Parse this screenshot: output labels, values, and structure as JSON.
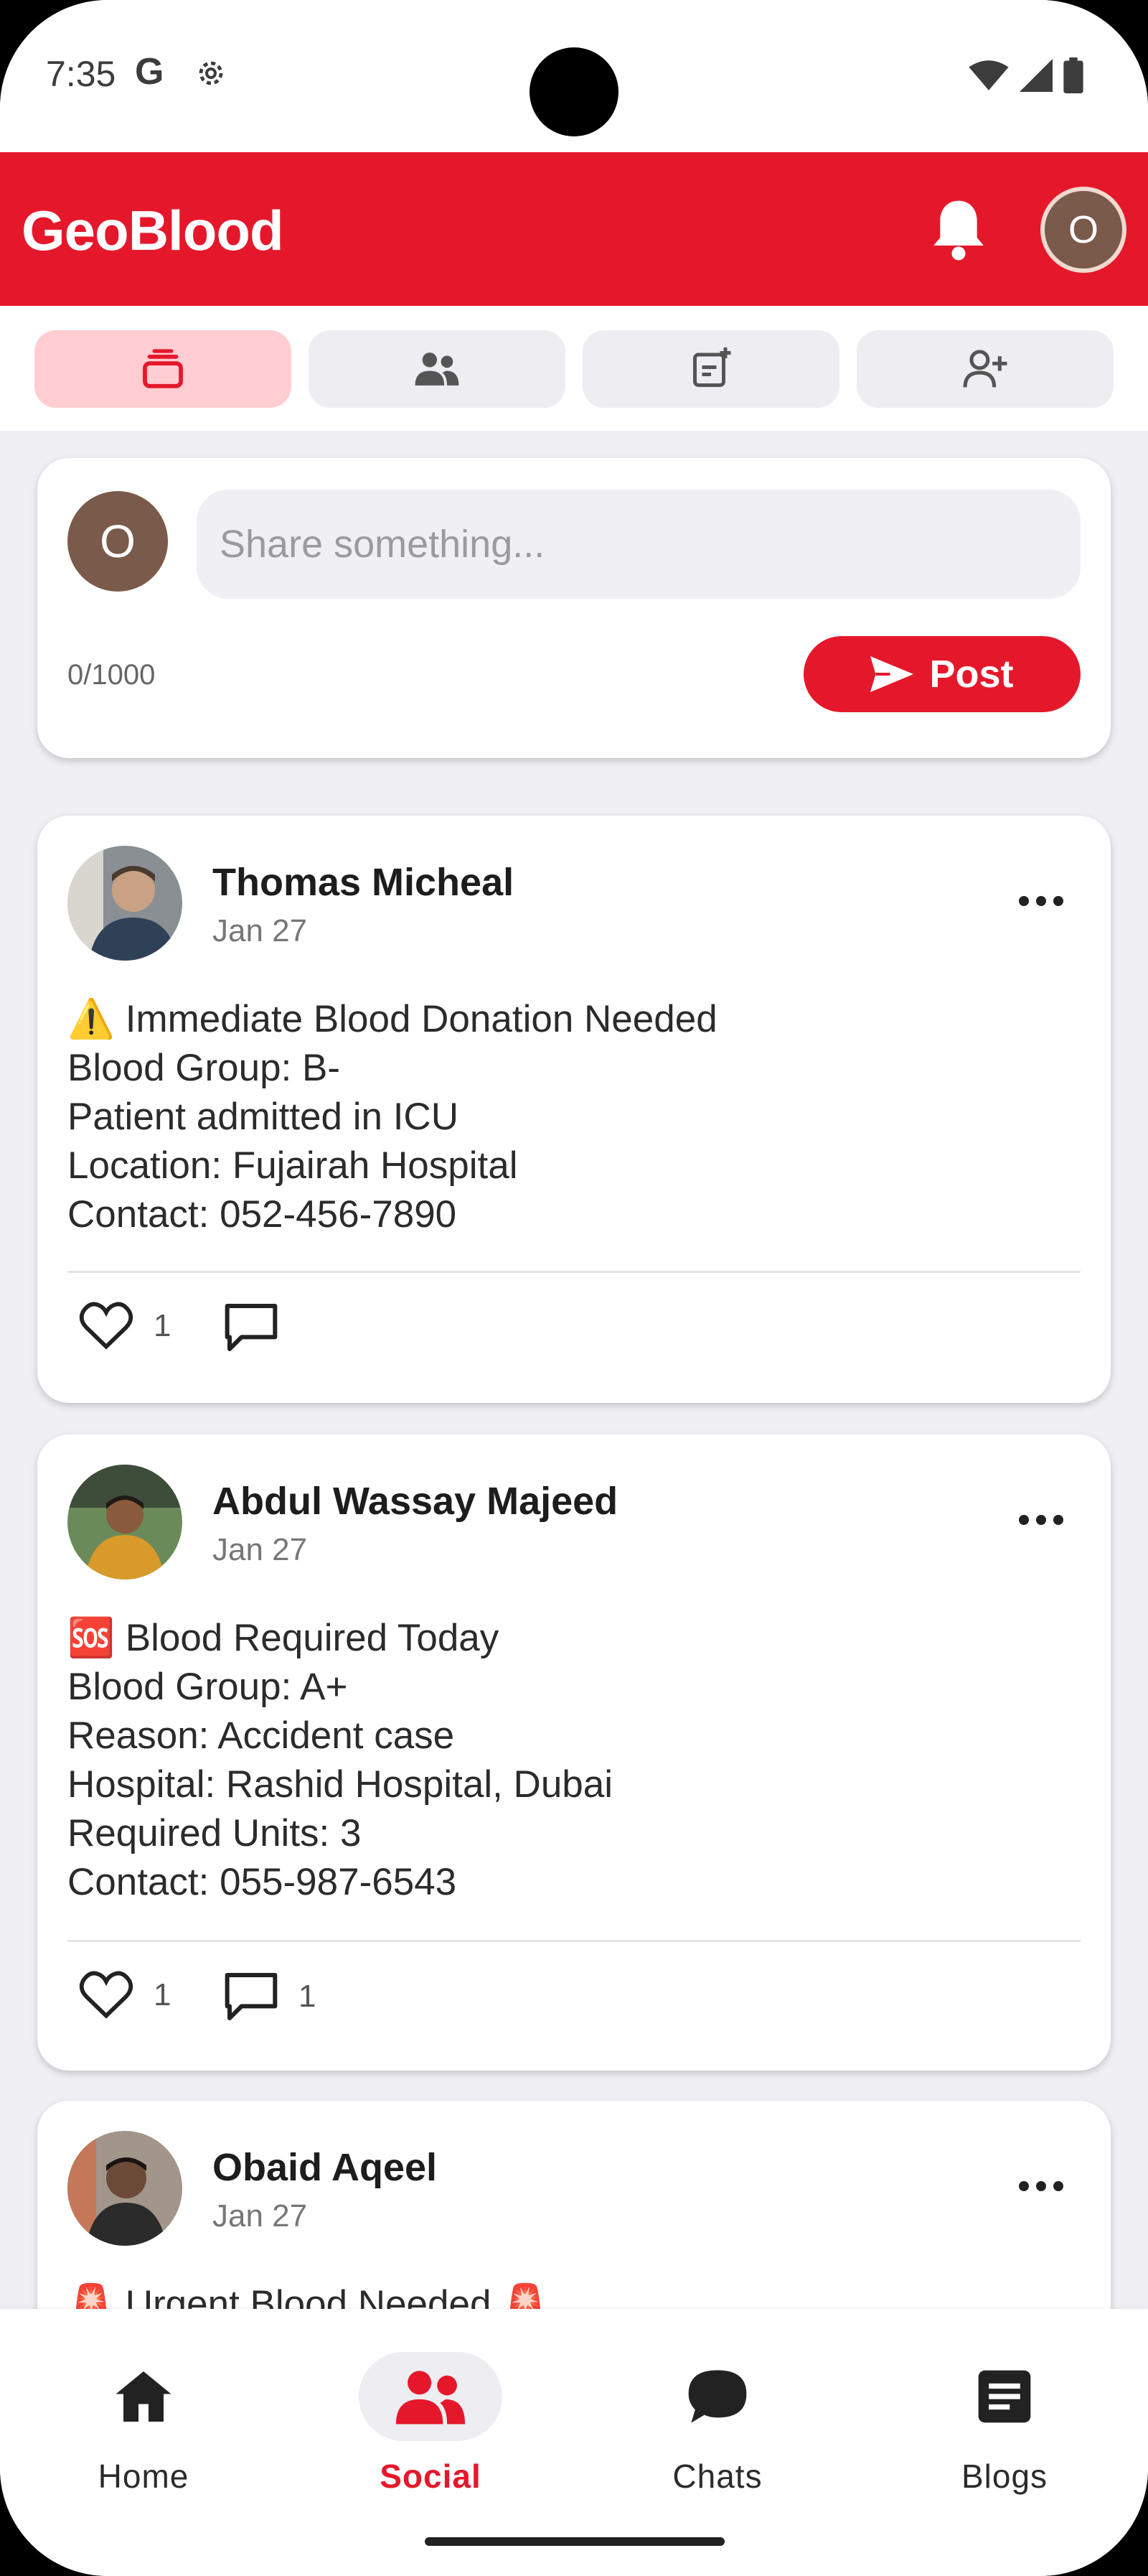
{
  "status_bar": {
    "time": "7:35",
    "g_label": "G"
  },
  "app_bar": {
    "title": "GeoBlood",
    "avatar_initial": "O"
  },
  "composer": {
    "avatar_initial": "O",
    "placeholder": "Share something...",
    "char_count": "0/1000",
    "post_label": "Post"
  },
  "posts": [
    {
      "author": "Thomas Micheal",
      "date": "Jan 27",
      "body": "⚠️ Immediate Blood Donation Needed\nBlood Group: B-\nPatient admitted in ICU\nLocation: Fujairah Hospital\nContact: 052-456-7890",
      "likes": "1",
      "comments": ""
    },
    {
      "author": "Abdul Wassay Majeed",
      "date": "Jan 27",
      "body": "🆘 Blood Required Today\nBlood Group: A+\nReason: Accident case\nHospital: Rashid Hospital, Dubai\nRequired Units: 3\nContact: 055-987-6543",
      "likes": "1",
      "comments": "1"
    },
    {
      "author": "Obaid Aqeel",
      "date": "Jan 27",
      "body": "🚨 Urgent Blood Needed 🚨",
      "likes": "",
      "comments": ""
    }
  ],
  "bottom_nav": [
    {
      "label": "Home",
      "icon": "home-icon"
    },
    {
      "label": "Social",
      "icon": "people-icon",
      "active": true
    },
    {
      "label": "Chats",
      "icon": "chat-icon"
    },
    {
      "label": "Blogs",
      "icon": "article-icon"
    }
  ],
  "colors": {
    "primary": "#e5182b",
    "active_tab": "#ffcdd2",
    "background": "#efeff4"
  }
}
